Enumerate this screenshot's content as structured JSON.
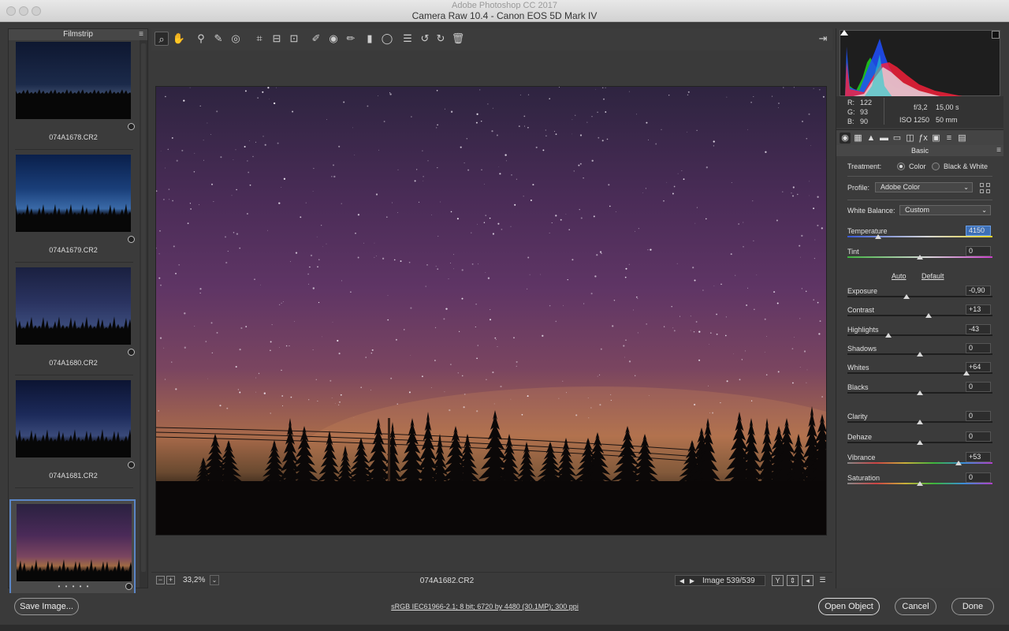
{
  "window": {
    "app_title": "Adobe Photoshop CC 2017",
    "title": "Camera Raw 10.4  -  Canon EOS 5D Mark IV"
  },
  "filmstrip": {
    "header": "Filmstrip",
    "items": [
      {
        "name": "074A1678.CR2",
        "selected": false
      },
      {
        "name": "074A1679.CR2",
        "selected": false
      },
      {
        "name": "074A1680.CR2",
        "selected": false
      },
      {
        "name": "074A1681.CR2",
        "selected": false
      },
      {
        "name": "074A1682.CR2",
        "selected": true,
        "rating_dots": "• • • • •"
      }
    ]
  },
  "toolbar": {
    "tools": [
      "zoom-icon",
      "hand-icon",
      "white-balance-icon",
      "color-sampler-icon",
      "targeted-adjustment-icon",
      "crop-icon",
      "straighten-icon",
      "transform-icon",
      "spot-removal-icon",
      "red-eye-icon",
      "adjustment-brush-icon",
      "graduated-filter-icon",
      "radial-filter-icon",
      "presets-icon",
      "rotate-ccw-icon",
      "rotate-cw-icon",
      "trash-icon"
    ],
    "active_tool": "zoom-icon"
  },
  "image_status": {
    "zoom": "33,2%",
    "filename": "074A1682.CR2",
    "image_counter": "Image 539/539"
  },
  "histogram": {
    "rgb": {
      "r_label": "R:",
      "r": "122",
      "g_label": "G:",
      "g": "93",
      "b_label": "B:",
      "b": "90"
    },
    "aperture": "f/3,2",
    "shutter": "15,00 s",
    "iso": "ISO 1250",
    "focal": "50 mm"
  },
  "panel": {
    "title": "Basic",
    "treatment_label": "Treatment:",
    "treatment_color": "Color",
    "treatment_bw": "Black & White",
    "treatment_selected": "Color",
    "profile_label": "Profile:",
    "profile_value": "Adobe Color",
    "wb_label": "White Balance:",
    "wb_value": "Custom",
    "auto_link": "Auto",
    "default_link": "Default",
    "sliders": [
      {
        "label": "Temperature",
        "value": "4150",
        "fraction": 0.21
      },
      {
        "label": "Tint",
        "value": "0",
        "fraction": 0.5
      },
      {
        "label": "Exposure",
        "value": "-0,90",
        "fraction": 0.41
      },
      {
        "label": "Contrast",
        "value": "+13",
        "fraction": 0.56
      },
      {
        "label": "Highlights",
        "value": "-43",
        "fraction": 0.28
      },
      {
        "label": "Shadows",
        "value": "0",
        "fraction": 0.5
      },
      {
        "label": "Whites",
        "value": "+64",
        "fraction": 0.82
      },
      {
        "label": "Blacks",
        "value": "0",
        "fraction": 0.5
      },
      {
        "label": "Clarity",
        "value": "0",
        "fraction": 0.5
      },
      {
        "label": "Dehaze",
        "value": "0",
        "fraction": 0.5
      },
      {
        "label": "Vibrance",
        "value": "+53",
        "fraction": 0.765
      },
      {
        "label": "Saturation",
        "value": "0",
        "fraction": 0.5
      }
    ]
  },
  "bottom": {
    "save_label": "Save Image...",
    "workflow_link": "sRGB IEC61966-2.1; 8 bit; 6720 by 4480 (30.1MP); 300 ppi",
    "open_label": "Open Object",
    "cancel_label": "Cancel",
    "done_label": "Done"
  }
}
